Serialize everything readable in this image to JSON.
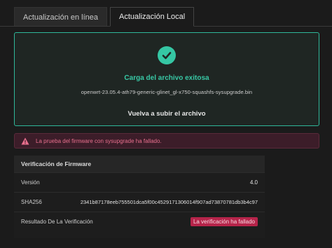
{
  "tabs": [
    {
      "label": "Actualización en línea",
      "active": false
    },
    {
      "label": "Actualización Local",
      "active": true
    }
  ],
  "upload": {
    "status_icon": "check-circle-icon",
    "title": "Carga del archivo exitosa",
    "filename": "openwrt-23.05.4-ath79-generic-glinet_gl-x750-squashfs-sysupgrade.bin",
    "reupload_label": "Vuelva a subir el archivo"
  },
  "alert": {
    "icon": "warning-triangle-icon",
    "message": "La prueba del firmware con sysupgrade ha fallado."
  },
  "verification": {
    "header": "Verificación de Firmware",
    "rows": [
      {
        "label": "Versión",
        "value": "4.0"
      },
      {
        "label": "SHA256",
        "value": "2341b87178eeb755501dca5f00c4529171306014f907ad73870781db3b4c97"
      },
      {
        "label": "Resultado De La Verificación",
        "value": "La verificación ha fallado"
      }
    ]
  },
  "colors": {
    "accent": "#35c7a4",
    "error": "#b6244a",
    "background": "#1b1b1b"
  }
}
